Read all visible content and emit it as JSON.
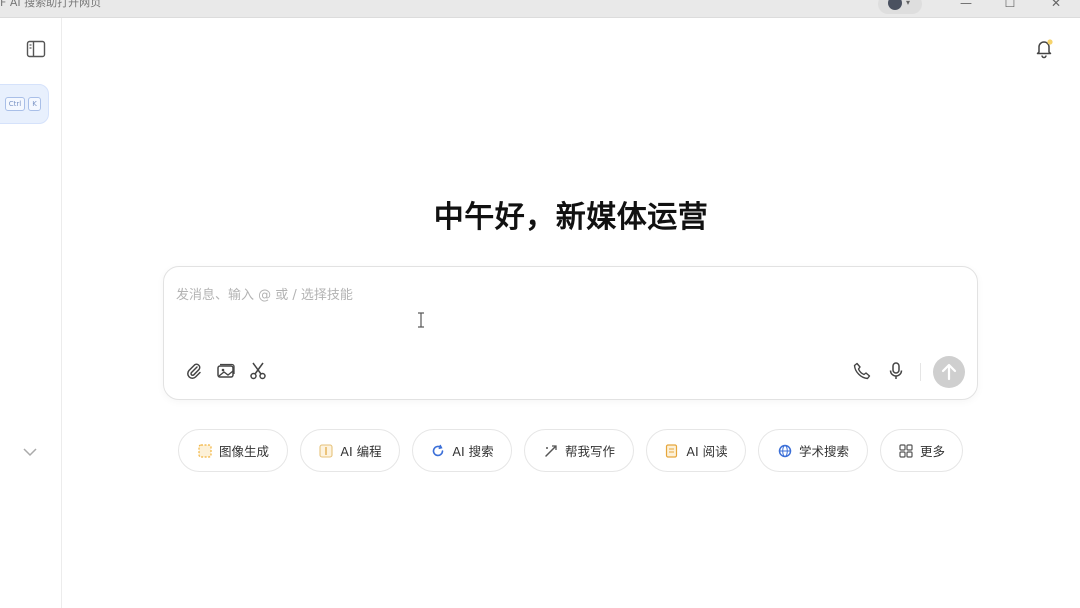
{
  "window": {
    "title": "F AI 搜索助打开网页",
    "minimize_glyph": "—",
    "maximize_glyph": "☐",
    "close_glyph": "✕"
  },
  "sidebar": {
    "shortcut": {
      "ctrl": "Ctrl",
      "key": "K"
    },
    "icons": [
      "sidebar-panel-icon",
      "chevron-down-icon"
    ]
  },
  "header": {
    "bell_icon": "bell-icon"
  },
  "main": {
    "greeting": "中午好，新媒体运营",
    "composer": {
      "placeholder": "发消息、输入 @ 或 / 选择技能",
      "value": "",
      "left_tools": [
        "paperclip-icon",
        "image-icon",
        "scissors-icon"
      ],
      "right_tools": [
        "phone-icon",
        "microphone-icon",
        "send-arrow-icon"
      ]
    },
    "quick_actions": [
      {
        "label": "图像生成",
        "icon": "image-gen-icon",
        "color": "#f2b33d"
      },
      {
        "label": "AI 编程",
        "icon": "code-icon",
        "color": "#e0a53a"
      },
      {
        "label": "AI 搜索",
        "icon": "search-refresh-icon",
        "color": "#3b6fd8"
      },
      {
        "label": "帮我写作",
        "icon": "pen-icon",
        "color": "#555555"
      },
      {
        "label": "AI 阅读",
        "icon": "reading-icon",
        "color": "#e6a63c"
      },
      {
        "label": "学术搜索",
        "icon": "globe-icon",
        "color": "#3b6fd8"
      },
      {
        "label": "更多",
        "icon": "grid-more-icon",
        "color": "#555555"
      }
    ]
  }
}
